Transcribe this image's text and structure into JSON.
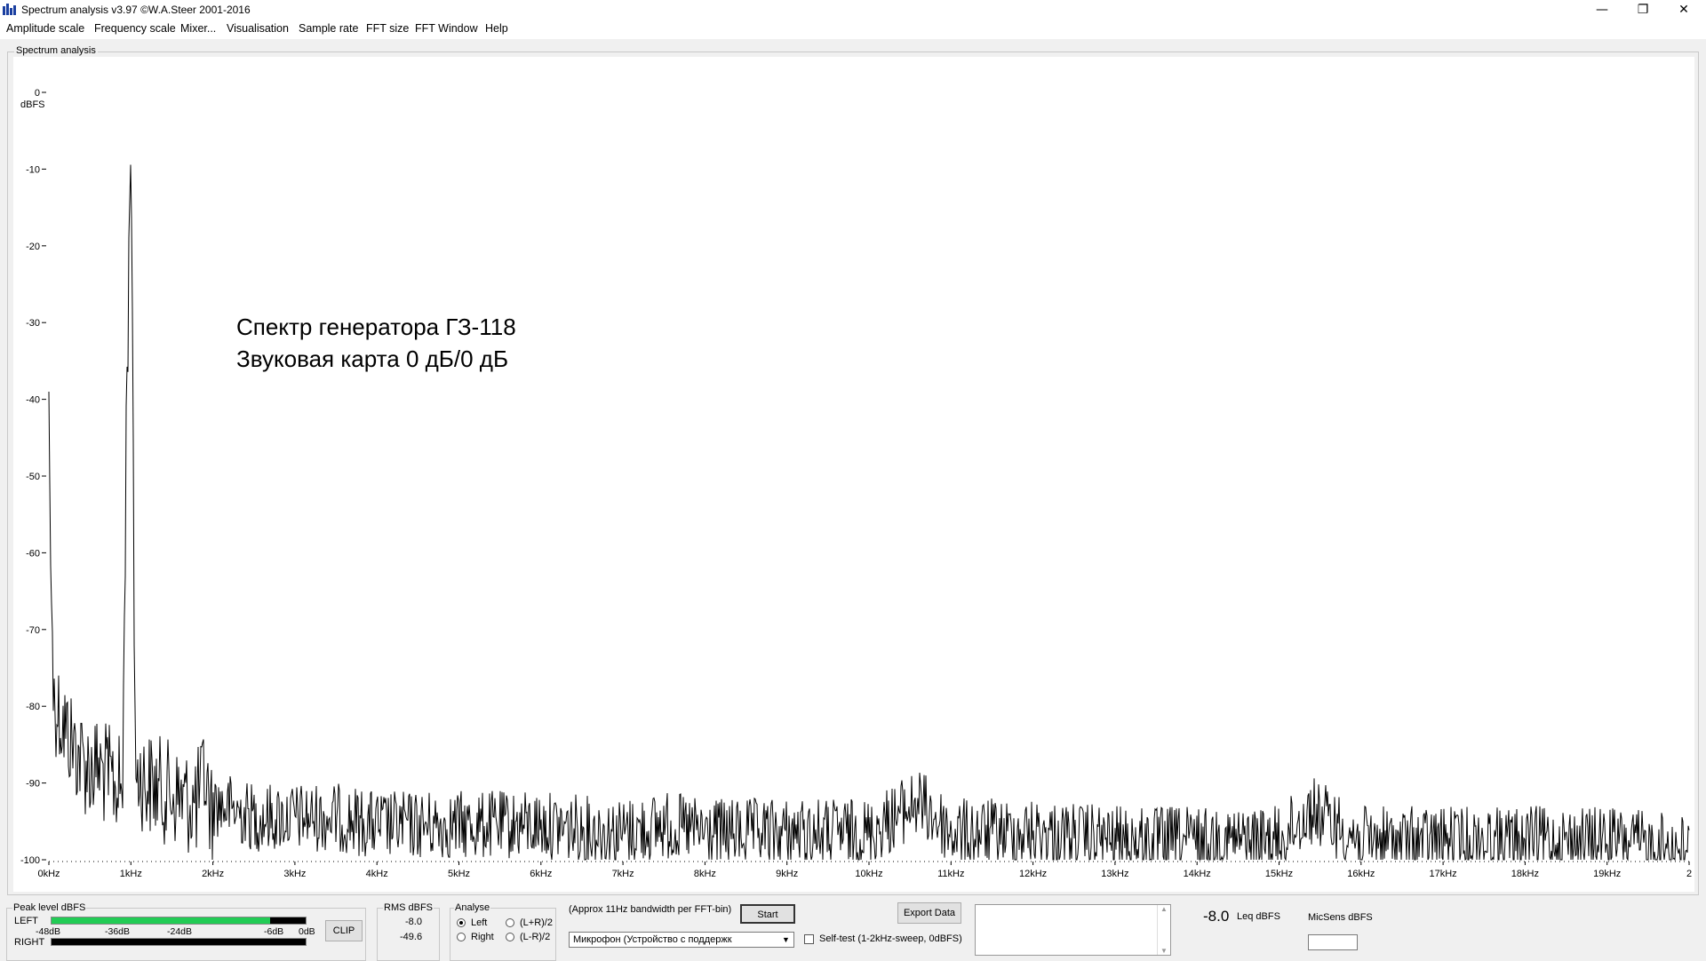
{
  "window": {
    "title": "Spectrum analysis v3.97  ©W.A.Steer 2001-2016",
    "minimize_glyph": "—",
    "restore_glyph": "❐",
    "close_glyph": "✕"
  },
  "menu": [
    "Amplitude scale",
    "Frequency scale",
    "Mixer...",
    "Visualisation",
    "Sample rate",
    "FFT size",
    "FFT Window",
    "Help"
  ],
  "spectrum_group_label": "Spectrum analysis",
  "annotation": {
    "line1": "Спектр генератора ГЗ-118",
    "line2": "Звуковая карта 0 дБ/0 дБ"
  },
  "chart_data": {
    "type": "line",
    "ylabel": "dBFS",
    "ylim": [
      -100,
      0
    ],
    "xlim": [
      0,
      20
    ],
    "y_ticks": [
      "0",
      "-10",
      "-20",
      "-30",
      "-40",
      "-50",
      "-60",
      "-70",
      "-80",
      "-90",
      "-100"
    ],
    "x_ticks": [
      "0kHz",
      "1kHz",
      "2kHz",
      "3kHz",
      "4kHz",
      "5kHz",
      "6kHz",
      "7kHz",
      "8kHz",
      "9kHz",
      "10kHz",
      "11kHz",
      "12kHz",
      "13kHz",
      "14kHz",
      "15kHz",
      "16kHz",
      "17kHz",
      "18kHz",
      "19kHz",
      "2"
    ],
    "series": [
      {
        "x_khz": [
          0.0,
          0.02,
          0.04,
          0.06,
          0.1,
          0.2,
          0.3,
          0.4,
          0.5,
          0.6,
          0.7,
          0.8,
          0.9,
          0.95,
          1.0,
          1.02,
          1.05,
          1.1,
          1.2,
          1.4,
          1.6,
          1.8,
          1.9,
          2.0,
          2.5,
          3.0,
          3.5,
          4.0,
          5.0,
          5.5,
          6.0,
          7.0,
          7.5,
          8.0,
          9.0,
          10.0,
          10.6,
          11.0,
          12.0,
          13.0,
          14.0,
          15.0,
          15.4,
          16.0,
          17.0,
          18.0,
          19.0,
          19.9
        ],
        "peak_dbfs": [
          -39,
          -61,
          -70,
          -72,
          -73,
          -76,
          -78,
          -80,
          -81,
          -81,
          -82,
          -83,
          -84,
          -30,
          -8,
          -30,
          -80,
          -82,
          -83,
          -84,
          -85,
          -86,
          -82,
          -88,
          -90,
          -90,
          -90,
          -91,
          -91,
          -91,
          -91,
          -92,
          -91,
          -92,
          -92,
          -92,
          -88,
          -92,
          -92,
          -93,
          -93,
          -93,
          -89,
          -93,
          -93,
          -93,
          -93,
          -94
        ]
      }
    ]
  },
  "peak_level": {
    "label": "Peak level dBFS",
    "left_label": "LEFT",
    "right_label": "RIGHT",
    "scale": [
      "-48dB",
      "-36dB",
      "-24dB",
      "-6dB",
      "0dB"
    ],
    "left_fraction": 0.86,
    "right_fraction": 0.0,
    "clip_label": "CLIP"
  },
  "rms": {
    "label": "RMS dBFS",
    "left": "-8.0",
    "right": "-49.6"
  },
  "analyse": {
    "label": "Analyse",
    "options": [
      "Left",
      "Right",
      "(L+R)/2",
      "(L-R)/2"
    ],
    "selected": "Left"
  },
  "bandwidth_note": "(Approx 11Hz bandwidth per FFT-bin)",
  "start_label": "Start",
  "device": "Микрофон (Устройство с поддержк",
  "selftest_label": "Self-test  (1-2kHz-sweep, 0dBFS)",
  "export_label": "Export Data",
  "leq": {
    "value": "-8.0",
    "unit": "Leq dBFS"
  },
  "micsens_label": "MicSens dBFS",
  "colors": {
    "meter_green": "#22cc55",
    "plot_bg": "#ffffff",
    "trace": "#000000"
  }
}
